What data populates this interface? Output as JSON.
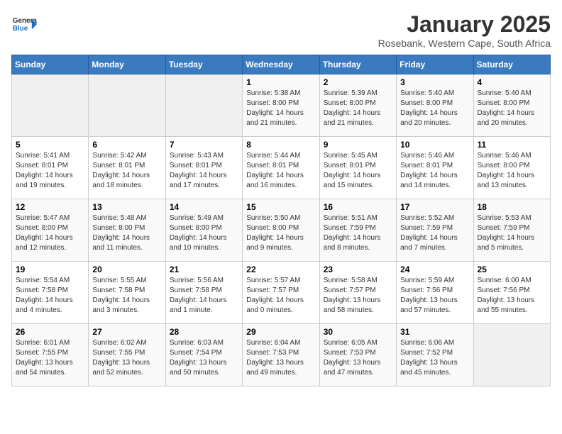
{
  "header": {
    "logo": {
      "general": "General",
      "blue": "Blue"
    },
    "title": "January 2025",
    "location": "Rosebank, Western Cape, South Africa"
  },
  "weekdays": [
    "Sunday",
    "Monday",
    "Tuesday",
    "Wednesday",
    "Thursday",
    "Friday",
    "Saturday"
  ],
  "weeks": [
    [
      {
        "day": "",
        "info": ""
      },
      {
        "day": "",
        "info": ""
      },
      {
        "day": "",
        "info": ""
      },
      {
        "day": "1",
        "info": "Sunrise: 5:38 AM\nSunset: 8:00 PM\nDaylight: 14 hours\nand 21 minutes."
      },
      {
        "day": "2",
        "info": "Sunrise: 5:39 AM\nSunset: 8:00 PM\nDaylight: 14 hours\nand 21 minutes."
      },
      {
        "day": "3",
        "info": "Sunrise: 5:40 AM\nSunset: 8:00 PM\nDaylight: 14 hours\nand 20 minutes."
      },
      {
        "day": "4",
        "info": "Sunrise: 5:40 AM\nSunset: 8:00 PM\nDaylight: 14 hours\nand 20 minutes."
      }
    ],
    [
      {
        "day": "5",
        "info": "Sunrise: 5:41 AM\nSunset: 8:01 PM\nDaylight: 14 hours\nand 19 minutes."
      },
      {
        "day": "6",
        "info": "Sunrise: 5:42 AM\nSunset: 8:01 PM\nDaylight: 14 hours\nand 18 minutes."
      },
      {
        "day": "7",
        "info": "Sunrise: 5:43 AM\nSunset: 8:01 PM\nDaylight: 14 hours\nand 17 minutes."
      },
      {
        "day": "8",
        "info": "Sunrise: 5:44 AM\nSunset: 8:01 PM\nDaylight: 14 hours\nand 16 minutes."
      },
      {
        "day": "9",
        "info": "Sunrise: 5:45 AM\nSunset: 8:01 PM\nDaylight: 14 hours\nand 15 minutes."
      },
      {
        "day": "10",
        "info": "Sunrise: 5:46 AM\nSunset: 8:01 PM\nDaylight: 14 hours\nand 14 minutes."
      },
      {
        "day": "11",
        "info": "Sunrise: 5:46 AM\nSunset: 8:00 PM\nDaylight: 14 hours\nand 13 minutes."
      }
    ],
    [
      {
        "day": "12",
        "info": "Sunrise: 5:47 AM\nSunset: 8:00 PM\nDaylight: 14 hours\nand 12 minutes."
      },
      {
        "day": "13",
        "info": "Sunrise: 5:48 AM\nSunset: 8:00 PM\nDaylight: 14 hours\nand 11 minutes."
      },
      {
        "day": "14",
        "info": "Sunrise: 5:49 AM\nSunset: 8:00 PM\nDaylight: 14 hours\nand 10 minutes."
      },
      {
        "day": "15",
        "info": "Sunrise: 5:50 AM\nSunset: 8:00 PM\nDaylight: 14 hours\nand 9 minutes."
      },
      {
        "day": "16",
        "info": "Sunrise: 5:51 AM\nSunset: 7:59 PM\nDaylight: 14 hours\nand 8 minutes."
      },
      {
        "day": "17",
        "info": "Sunrise: 5:52 AM\nSunset: 7:59 PM\nDaylight: 14 hours\nand 7 minutes."
      },
      {
        "day": "18",
        "info": "Sunrise: 5:53 AM\nSunset: 7:59 PM\nDaylight: 14 hours\nand 5 minutes."
      }
    ],
    [
      {
        "day": "19",
        "info": "Sunrise: 5:54 AM\nSunset: 7:58 PM\nDaylight: 14 hours\nand 4 minutes."
      },
      {
        "day": "20",
        "info": "Sunrise: 5:55 AM\nSunset: 7:58 PM\nDaylight: 14 hours\nand 3 minutes."
      },
      {
        "day": "21",
        "info": "Sunrise: 5:56 AM\nSunset: 7:58 PM\nDaylight: 14 hours\nand 1 minute."
      },
      {
        "day": "22",
        "info": "Sunrise: 5:57 AM\nSunset: 7:57 PM\nDaylight: 14 hours\nand 0 minutes."
      },
      {
        "day": "23",
        "info": "Sunrise: 5:58 AM\nSunset: 7:57 PM\nDaylight: 13 hours\nand 58 minutes."
      },
      {
        "day": "24",
        "info": "Sunrise: 5:59 AM\nSunset: 7:56 PM\nDaylight: 13 hours\nand 57 minutes."
      },
      {
        "day": "25",
        "info": "Sunrise: 6:00 AM\nSunset: 7:56 PM\nDaylight: 13 hours\nand 55 minutes."
      }
    ],
    [
      {
        "day": "26",
        "info": "Sunrise: 6:01 AM\nSunset: 7:55 PM\nDaylight: 13 hours\nand 54 minutes."
      },
      {
        "day": "27",
        "info": "Sunrise: 6:02 AM\nSunset: 7:55 PM\nDaylight: 13 hours\nand 52 minutes."
      },
      {
        "day": "28",
        "info": "Sunrise: 6:03 AM\nSunset: 7:54 PM\nDaylight: 13 hours\nand 50 minutes."
      },
      {
        "day": "29",
        "info": "Sunrise: 6:04 AM\nSunset: 7:53 PM\nDaylight: 13 hours\nand 49 minutes."
      },
      {
        "day": "30",
        "info": "Sunrise: 6:05 AM\nSunset: 7:53 PM\nDaylight: 13 hours\nand 47 minutes."
      },
      {
        "day": "31",
        "info": "Sunrise: 6:06 AM\nSunset: 7:52 PM\nDaylight: 13 hours\nand 45 minutes."
      },
      {
        "day": "",
        "info": ""
      }
    ]
  ]
}
